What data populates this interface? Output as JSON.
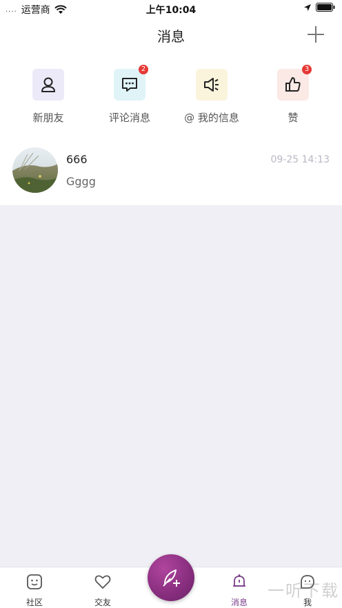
{
  "status_bar": {
    "signal": "....",
    "carrier": "运营商",
    "time": "上午10:04"
  },
  "header": {
    "title": "消息",
    "add_icon": "plus-icon"
  },
  "categories": [
    {
      "label": "新朋友",
      "icon": "user-icon",
      "bg": "#ece9f8",
      "badge": ""
    },
    {
      "label": "评论消息",
      "icon": "chat-icon",
      "bg": "#e0f4f8",
      "badge": "2"
    },
    {
      "label": "@ 我的信息",
      "icon": "megaphone-icon",
      "bg": "#fbf4dc",
      "badge": ""
    },
    {
      "label": "赞",
      "icon": "thumbs-up-icon",
      "bg": "#fbe9e6",
      "badge": "3"
    }
  ],
  "messages": [
    {
      "name": "666",
      "text": "Gggg",
      "time": "09-25 14:13"
    }
  ],
  "tab_bar": {
    "tabs": [
      {
        "label": "社区",
        "icon": "community-icon"
      },
      {
        "label": "交友",
        "icon": "heart-icon"
      },
      {
        "label": "消息",
        "icon": "bell-icon",
        "active": true
      },
      {
        "label": "我",
        "icon": "profile-icon"
      }
    ],
    "fab_icon": "feather-plus-icon"
  },
  "watermark": "一听下载",
  "colors": {
    "accent": "#7a3c8a",
    "badge": "#e53935",
    "background": "#f0eff5"
  }
}
